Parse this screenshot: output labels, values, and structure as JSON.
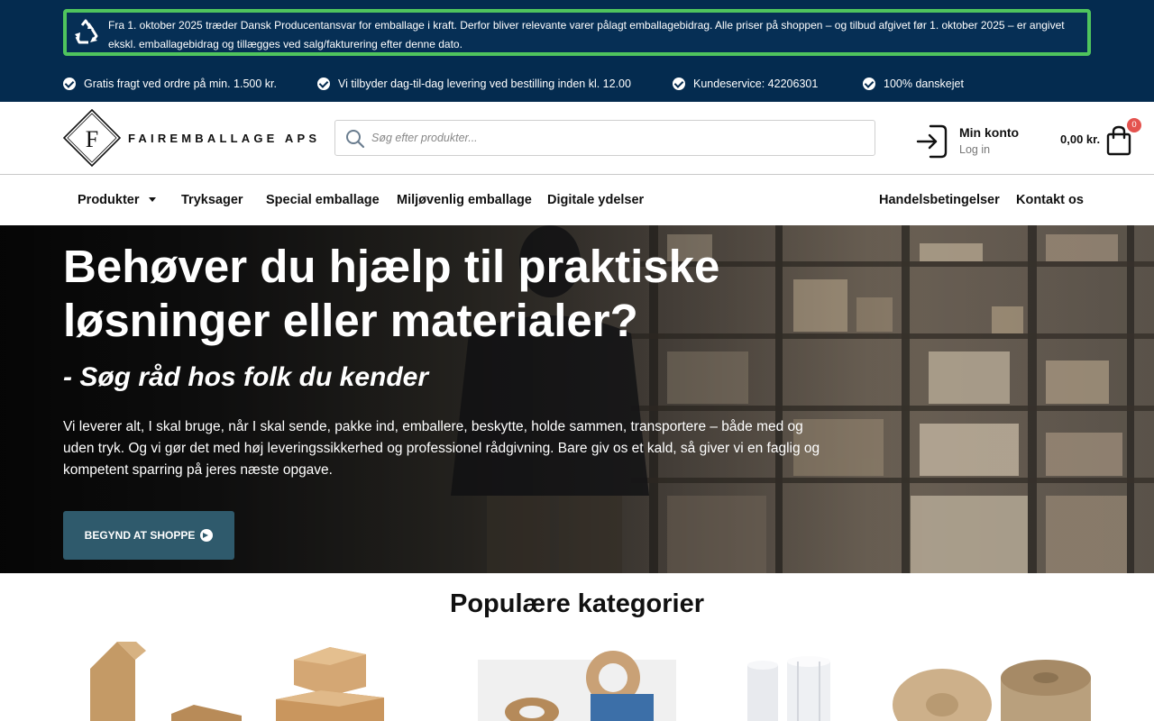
{
  "notice": {
    "text": "Fra 1. oktober 2025 træder Dansk Producentansvar for emballage i kraft. Derfor bliver relevante varer pålagt emballagebidrag. Alle priser på shoppen – og tilbud afgivet før 1. oktober 2025 – er angivet ekskl. emballagebidrag og tillægges ved salg/fakturering efter denne dato.",
    "icon": "recycle-icon"
  },
  "usps": [
    "Gratis fragt ved ordre på min. 1.500 kr.",
    "Vi tilbyder dag-til-dag levering ved bestilling inden kl. 12.00",
    "Kundeservice: 42206301",
    "100% danskejet"
  ],
  "header": {
    "logo_letter": "F",
    "logo_text": "FAIREMBALLAGE APS",
    "search_placeholder": "Søg efter produkter...",
    "account_title": "Min konto",
    "account_sub": "Log in",
    "cart_amount": "0,00 kr.",
    "cart_count": "0"
  },
  "nav": {
    "left": [
      "Produkter",
      "Tryksager",
      "Special emballage",
      "Miljøvenlig emballage",
      "Digitale ydelser"
    ],
    "right": [
      "Handelsbetingelser",
      "Kontakt os"
    ]
  },
  "hero": {
    "title": "Behøver du hjælp til praktiske løsninger eller materialer?",
    "subtitle": "- Søg råd hos folk du kender",
    "body": "Vi leverer alt, I skal bruge, når I skal sende, pakke ind, emballere, beskytte, holde sammen, transportere – både med og uden tryk. Og vi gør det med høj leveringssikkerhed og professionel rådgivning. Bare giv os et kald, så giver vi en faglig og kompetent sparring på jeres næste opgave.",
    "button": "BEGYND AT SHOPPE"
  },
  "categories": {
    "title": "Populære kategorier"
  },
  "colors": {
    "topband": "#042b4f",
    "notice_border": "#4fc45d",
    "button": "#2f5a6c",
    "badge": "#e4534f"
  }
}
